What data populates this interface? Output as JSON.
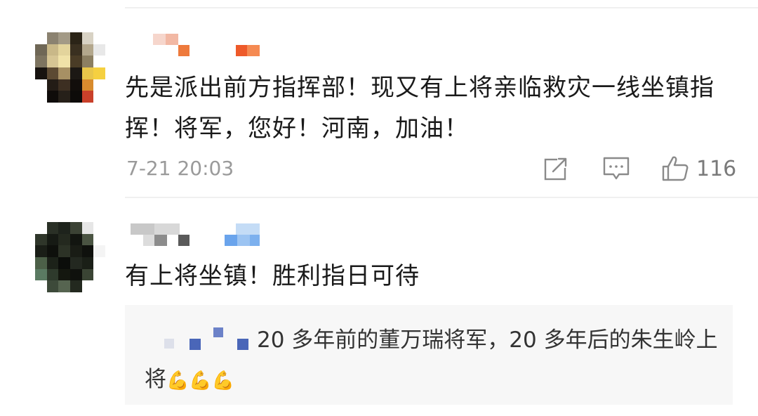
{
  "comments": [
    {
      "text": "先是派出前方指挥部！现又有上将亲临救灾一线坐镇指挥！将军，您好！河南，加油！",
      "time": "7-21 20:03",
      "likes": "116"
    },
    {
      "text": "有上将坐镇！胜利指日可待",
      "reply": {
        "text": "20 多年前的董万瑞将军，20 多年后的朱生岭上将",
        "emoji": "💪💪💪"
      }
    }
  ],
  "icons": {
    "share": "share-icon",
    "reply": "comment-icon",
    "like": "thumbs-up-icon"
  },
  "colors": {
    "divider": "#f0f0f0",
    "meta": "#9a9a9a",
    "reply_bg": "#f7f7f7"
  }
}
